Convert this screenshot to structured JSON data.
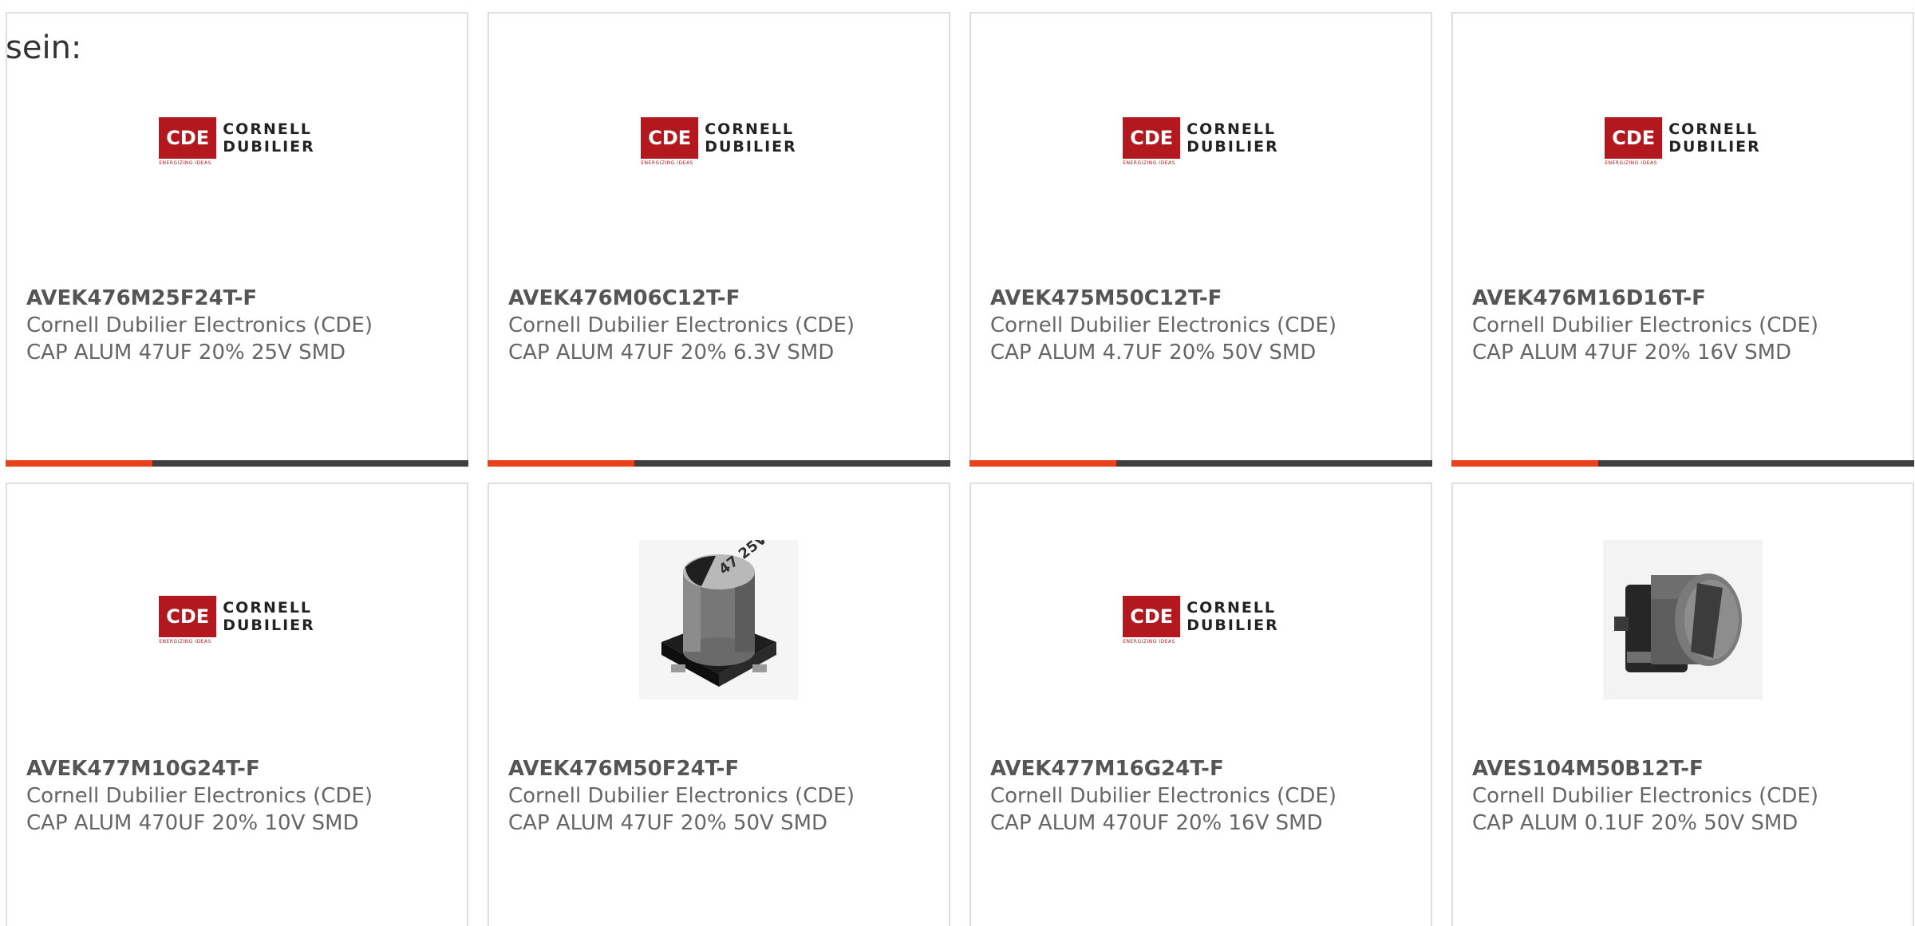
{
  "lead_text": "sein:",
  "brand_logo": {
    "mark": "CDE",
    "line1": "CORNELL",
    "line2": "DUBILIER",
    "tagline": "ENERGIZING IDEAS"
  },
  "colors": {
    "accent": "#e8411c",
    "bar": "#3f3f3f",
    "logo_red": "#b3181f"
  },
  "products": [
    {
      "part": "AVEK476M25F24T-F",
      "manufacturer": "Cornell Dubilier Electronics (CDE)",
      "description": "CAP ALUM 47UF 20% 25V SMD",
      "image": "brand-logo"
    },
    {
      "part": "AVEK476M06C12T-F",
      "manufacturer": "Cornell Dubilier Electronics (CDE)",
      "description": "CAP ALUM 47UF 20% 6.3V SMD",
      "image": "brand-logo"
    },
    {
      "part": "AVEK475M50C12T-F",
      "manufacturer": "Cornell Dubilier Electronics (CDE)",
      "description": "CAP ALUM 4.7UF 20% 50V SMD",
      "image": "brand-logo"
    },
    {
      "part": "AVEK476M16D16T-F",
      "manufacturer": "Cornell Dubilier Electronics (CDE)",
      "description": "CAP ALUM 47UF 20% 16V SMD",
      "image": "brand-logo"
    },
    {
      "part": "AVEK477M10G24T-F",
      "manufacturer": "Cornell Dubilier Electronics (CDE)",
      "description": "CAP ALUM 470UF 20% 10V SMD",
      "image": "brand-logo"
    },
    {
      "part": "AVEK476M50F24T-F",
      "manufacturer": "Cornell Dubilier Electronics (CDE)",
      "description": "CAP ALUM 47UF 20% 50V SMD",
      "image": "capacitor-photo",
      "photo_marking": "47 25V"
    },
    {
      "part": "AVEK477M16G24T-F",
      "manufacturer": "Cornell Dubilier Electronics (CDE)",
      "description": "CAP ALUM 470UF 20% 16V SMD",
      "image": "brand-logo"
    },
    {
      "part": "AVES104M50B12T-F",
      "manufacturer": "Cornell Dubilier Electronics (CDE)",
      "description": "CAP ALUM 0.1UF 20% 50V SMD",
      "image": "capacitor-side-photo"
    }
  ]
}
